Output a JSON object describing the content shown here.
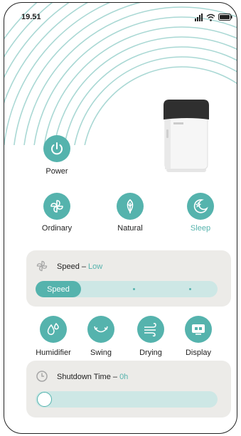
{
  "status_bar": {
    "time": "19.51"
  },
  "power": {
    "label": "Power"
  },
  "modes": [
    {
      "label": "Ordinary",
      "active": false
    },
    {
      "label": "Natural",
      "active": false
    },
    {
      "label": "Sleep",
      "active": true
    }
  ],
  "speed": {
    "title": "Speed – ",
    "value": "Low",
    "button_label": "Speed",
    "level_fraction": 0.25
  },
  "functions": [
    {
      "label": "Humidifier",
      "icon": "droplets-icon"
    },
    {
      "label": "Swing",
      "icon": "swing-arrows-icon"
    },
    {
      "label": "Drying",
      "icon": "wind-icon"
    },
    {
      "label": "Display",
      "icon": "display-icon"
    }
  ],
  "shutdown": {
    "title": "Shutdown Time – ",
    "value": "0h",
    "level_fraction": 0.0
  },
  "colors": {
    "accent": "#55b3ad",
    "card": "#ecebe8",
    "track": "#cde7e5"
  }
}
